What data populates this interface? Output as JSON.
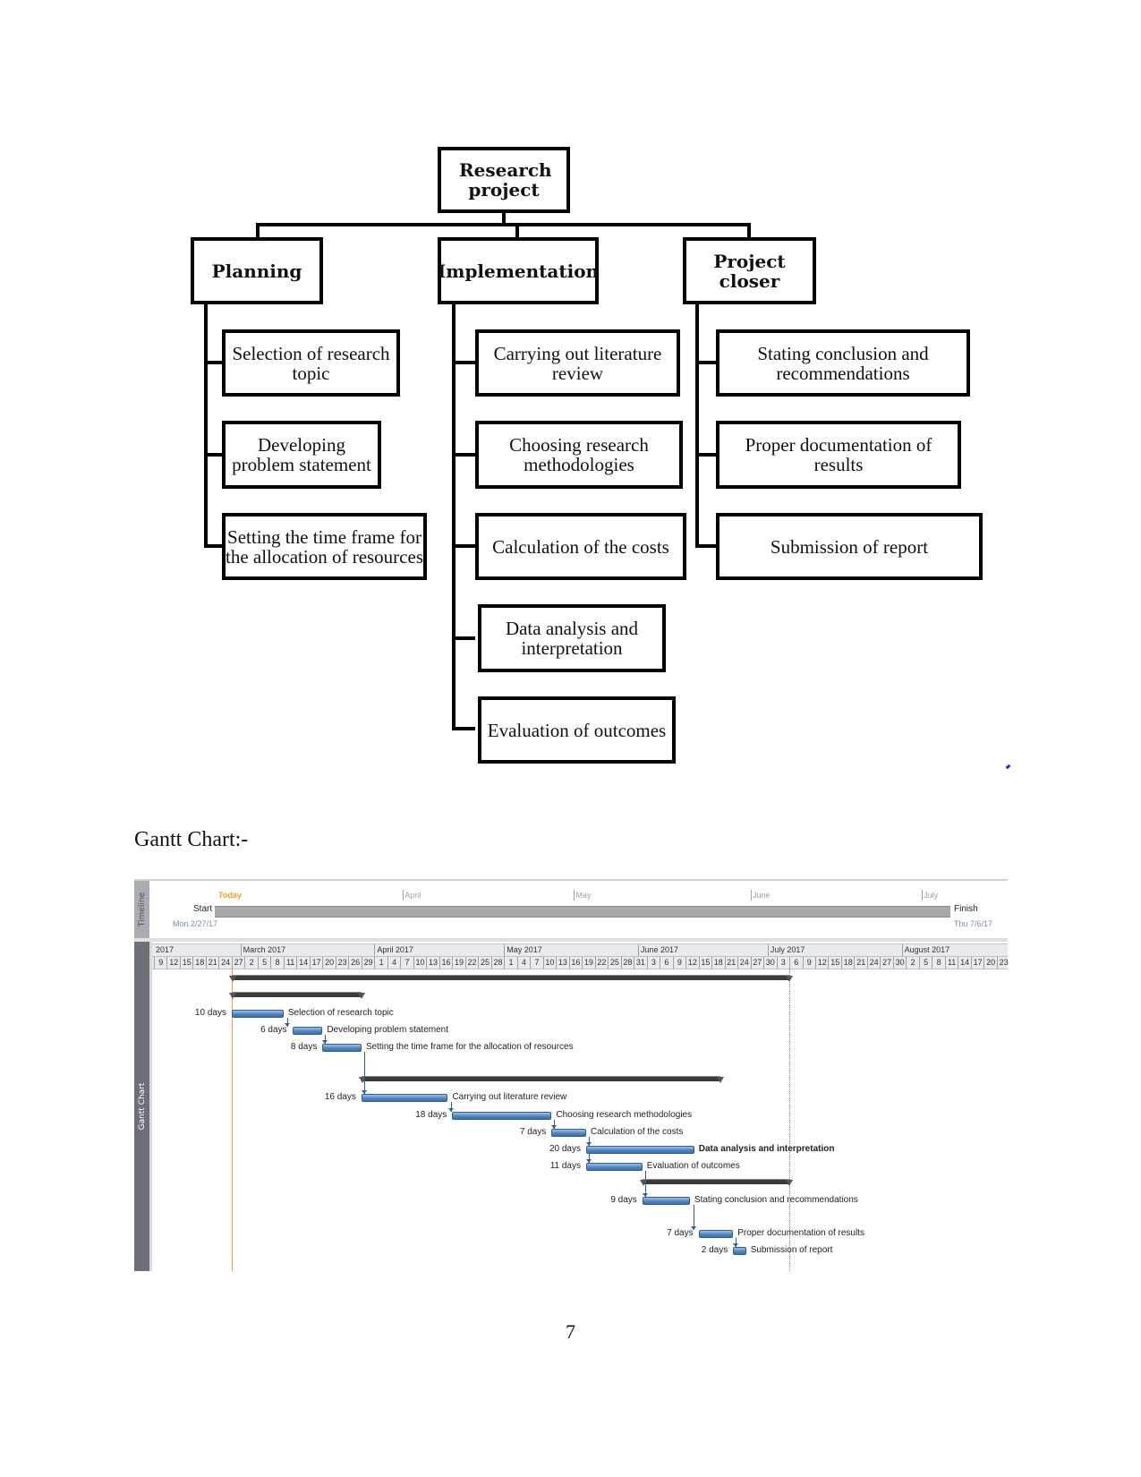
{
  "diagram": {
    "root": "Research project",
    "branches": [
      {
        "label": "Planning",
        "children": [
          "Selection of research topic",
          "Developing problem statement",
          "Setting the time frame for the allocation of resources"
        ]
      },
      {
        "label": "Implementation",
        "children": [
          "Carrying out literature review",
          "Choosing research methodologies",
          "Calculation of the costs",
          "Data analysis and interpretation",
          "Evaluation of outcomes"
        ]
      },
      {
        "label": "Project closer",
        "children": [
          "Stating conclusion and recommendations",
          "Proper documentation of results",
          "Submission of report"
        ]
      }
    ]
  },
  "gantt_caption": "Gantt Chart:-",
  "gantt": {
    "side_labels": {
      "timeline": "Timeline",
      "gantt": "Gantt Chart"
    },
    "timeline": {
      "today_label": "Today",
      "start_label": "Start",
      "start_date": "Mon 2/27/17",
      "finish_label": "Finish",
      "finish_date": "Thu 7/6/17",
      "month_marks": [
        "April",
        "May",
        "June",
        "July"
      ]
    },
    "header_months": [
      "2017",
      "March 2017",
      "April 2017",
      "May 2017",
      "June 2017",
      "July 2017",
      "August 2017"
    ],
    "header_days": [
      "9",
      "12",
      "15",
      "18",
      "21",
      "24",
      "27",
      "2",
      "5",
      "8",
      "11",
      "14",
      "17",
      "20",
      "23",
      "26",
      "29",
      "1",
      "4",
      "7",
      "10",
      "13",
      "16",
      "19",
      "22",
      "25",
      "28",
      "1",
      "4",
      "7",
      "10",
      "13",
      "16",
      "19",
      "22",
      "25",
      "28",
      "31",
      "3",
      "6",
      "9",
      "12",
      "15",
      "18",
      "21",
      "24",
      "27",
      "30",
      "3",
      "6",
      "9",
      "12",
      "15",
      "18",
      "21",
      "24",
      "27",
      "30",
      "2",
      "5",
      "8",
      "11",
      "14",
      "17",
      "20",
      "23"
    ],
    "colors": {
      "today": "#f0a030",
      "task": "#4f81bd",
      "summary": "#3a3a3a",
      "side": "#6d7177"
    }
  },
  "chart_data": {
    "type": "gantt",
    "title": "Gantt Chart",
    "project_start": "2017-02-27",
    "project_finish": "2017-07-06",
    "today": "2017-02-27",
    "axis_start": "2017-02-09",
    "summaries": [
      {
        "name": "Research project",
        "start": "2017-02-27",
        "end": "2017-07-06"
      },
      {
        "name": "Planning",
        "start": "2017-02-27",
        "end": "2017-03-29"
      },
      {
        "name": "Implementation",
        "start": "2017-03-29",
        "end": "2017-06-20"
      },
      {
        "name": "Project closer",
        "start": "2017-06-02",
        "end": "2017-07-06"
      }
    ],
    "tasks": [
      {
        "name": "Selection of research topic",
        "duration_label": "10 days",
        "start": "2017-02-27",
        "end": "2017-03-11",
        "bold": false
      },
      {
        "name": "Developing problem statement",
        "duration_label": "6 days",
        "start": "2017-03-13",
        "end": "2017-03-20",
        "bold": false
      },
      {
        "name": "Setting the time frame for the allocation of resources",
        "duration_label": "8 days",
        "start": "2017-03-20",
        "end": "2017-03-29",
        "bold": false
      },
      {
        "name": "Carrying out literature review",
        "duration_label": "16 days",
        "start": "2017-03-29",
        "end": "2017-04-18",
        "bold": false
      },
      {
        "name": "Choosing research methodologies",
        "duration_label": "18 days",
        "start": "2017-04-19",
        "end": "2017-05-12",
        "bold": false
      },
      {
        "name": "Calculation of the costs",
        "duration_label": "7 days",
        "start": "2017-05-12",
        "end": "2017-05-20",
        "bold": false
      },
      {
        "name": "Data analysis and interpretation",
        "duration_label": "20 days",
        "start": "2017-05-20",
        "end": "2017-06-14",
        "bold": true
      },
      {
        "name": "Evaluation of outcomes",
        "duration_label": "11 days",
        "start": "2017-05-20",
        "end": "2017-06-02",
        "bold": false
      },
      {
        "name": "Stating conclusion and recommendations",
        "duration_label": "9 days",
        "start": "2017-06-02",
        "end": "2017-06-13",
        "bold": false
      },
      {
        "name": "Proper documentation of results",
        "duration_label": "7 days",
        "start": "2017-06-15",
        "end": "2017-06-23",
        "bold": false
      },
      {
        "name": "Submission of report",
        "duration_label": "2 days",
        "start": "2017-06-23",
        "end": "2017-06-26",
        "bold": false
      }
    ]
  },
  "page_number": "7"
}
